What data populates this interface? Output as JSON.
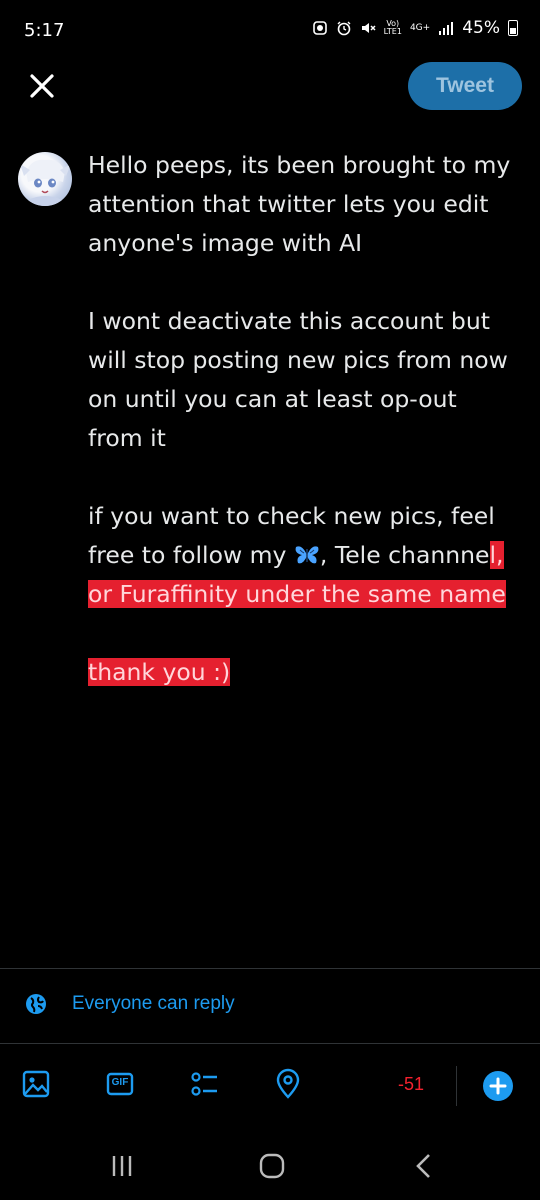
{
  "status_bar": {
    "time": "5:17",
    "volte": "Vo)",
    "lte": "LTE1",
    "network": "4G+",
    "battery": "45%",
    "icons": [
      "alarm-clock-icon",
      "alarm-icon",
      "mute-icon",
      "signal-icon",
      "battery-icon"
    ]
  },
  "header": {
    "close_icon": "close-icon",
    "tweet_label": "Tweet"
  },
  "post": {
    "para1": "Hello peeps, its been brought to my attention that twitter lets you edit anyone's image with AI",
    "para2": "I wont deactivate this account but will stop posting new pics from now on until you can at least op-out from it",
    "para3_a": "if you want to check new pics, feel free to follow my ",
    "para3_emoji": "butterfly-emoji",
    "para3_b": ", Tele channne",
    "para3_hl": "l, or Furaffinity under the same name",
    "para4": "thank you :)",
    "highlight_color": "#e5202f"
  },
  "reply_setting": {
    "icon": "globe-icon",
    "label": "Everyone can reply"
  },
  "toolbar": {
    "icons": [
      "image-icon",
      "gif-icon",
      "poll-icon",
      "location-icon"
    ],
    "gif_text": "GIF",
    "char_count": "-51",
    "add_icon": "plus-icon"
  },
  "colors": {
    "accent": "#1d9bf0",
    "tweet_button": "#1d6fa8",
    "error": "#f4212e",
    "background": "#000000"
  },
  "nav": {
    "icons": [
      "recent-apps-icon",
      "home-icon",
      "back-icon"
    ]
  }
}
